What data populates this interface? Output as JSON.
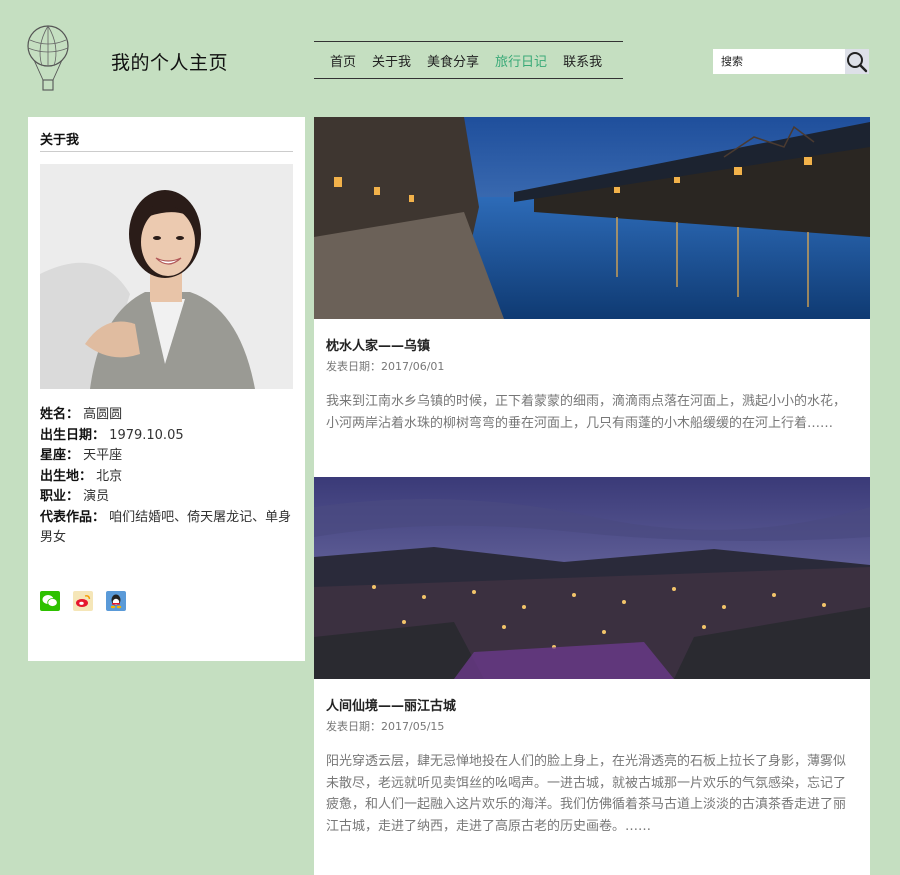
{
  "header": {
    "site_title": "我的个人主页",
    "nav": [
      {
        "label": "首页",
        "active": false
      },
      {
        "label": "关于我",
        "active": false
      },
      {
        "label": "美食分享",
        "active": false
      },
      {
        "label": "旅行日记",
        "active": true
      },
      {
        "label": "联系我",
        "active": false
      }
    ],
    "search": {
      "placeholder": "搜索",
      "icon": "search-icon"
    }
  },
  "sidebar": {
    "heading": "关于我",
    "profile": [
      {
        "label": "姓名",
        "value": "高圆圆"
      },
      {
        "label": "出生日期",
        "value": "1979.10.05"
      },
      {
        "label": "星座",
        "value": "天平座"
      },
      {
        "label": "出生地",
        "value": "北京"
      },
      {
        "label": "职业",
        "value": "演员"
      },
      {
        "label": "代表作品",
        "value": "咱们结婚吧、倚天屠龙记、单身男女"
      }
    ],
    "social": [
      "wechat-icon",
      "weibo-icon",
      "qq-icon"
    ]
  },
  "posts": [
    {
      "title": "枕水人家——乌镇",
      "date": "发表日期：2017/06/01",
      "excerpt": "我来到江南水乡乌镇的时候，正下着蒙蒙的细雨，滴滴雨点落在河面上，溅起小小的水花，小河两岸沾着水珠的柳树弯弯的垂在河面上，几只有雨蓬的小木船缓缓的在河上行着……"
    },
    {
      "title": "人间仙境——丽江古城",
      "date": "发表日期：2017/05/15",
      "excerpt": "阳光穿透云层，肆无忌惮地投在人们的脸上身上，在光滑透亮的石板上拉长了身影，薄雾似未散尽，老远就听见卖饵丝的吆喝声。一进古城，就被古城那一片欢乐的气氛感染，忘记了疲惫，和人们一起融入这片欢乐的海洋。我们仿佛循着茶马古道上淡淡的古滇茶香走进了丽江古城，走进了纳西，走进了高原古老的历史画卷。……"
    }
  ],
  "colors": {
    "background": "#c5dfc1",
    "nav_active": "#3aaa78",
    "wechat": "#2dc100",
    "weibo": "#f5c242",
    "qq": "#5a9ad8"
  }
}
